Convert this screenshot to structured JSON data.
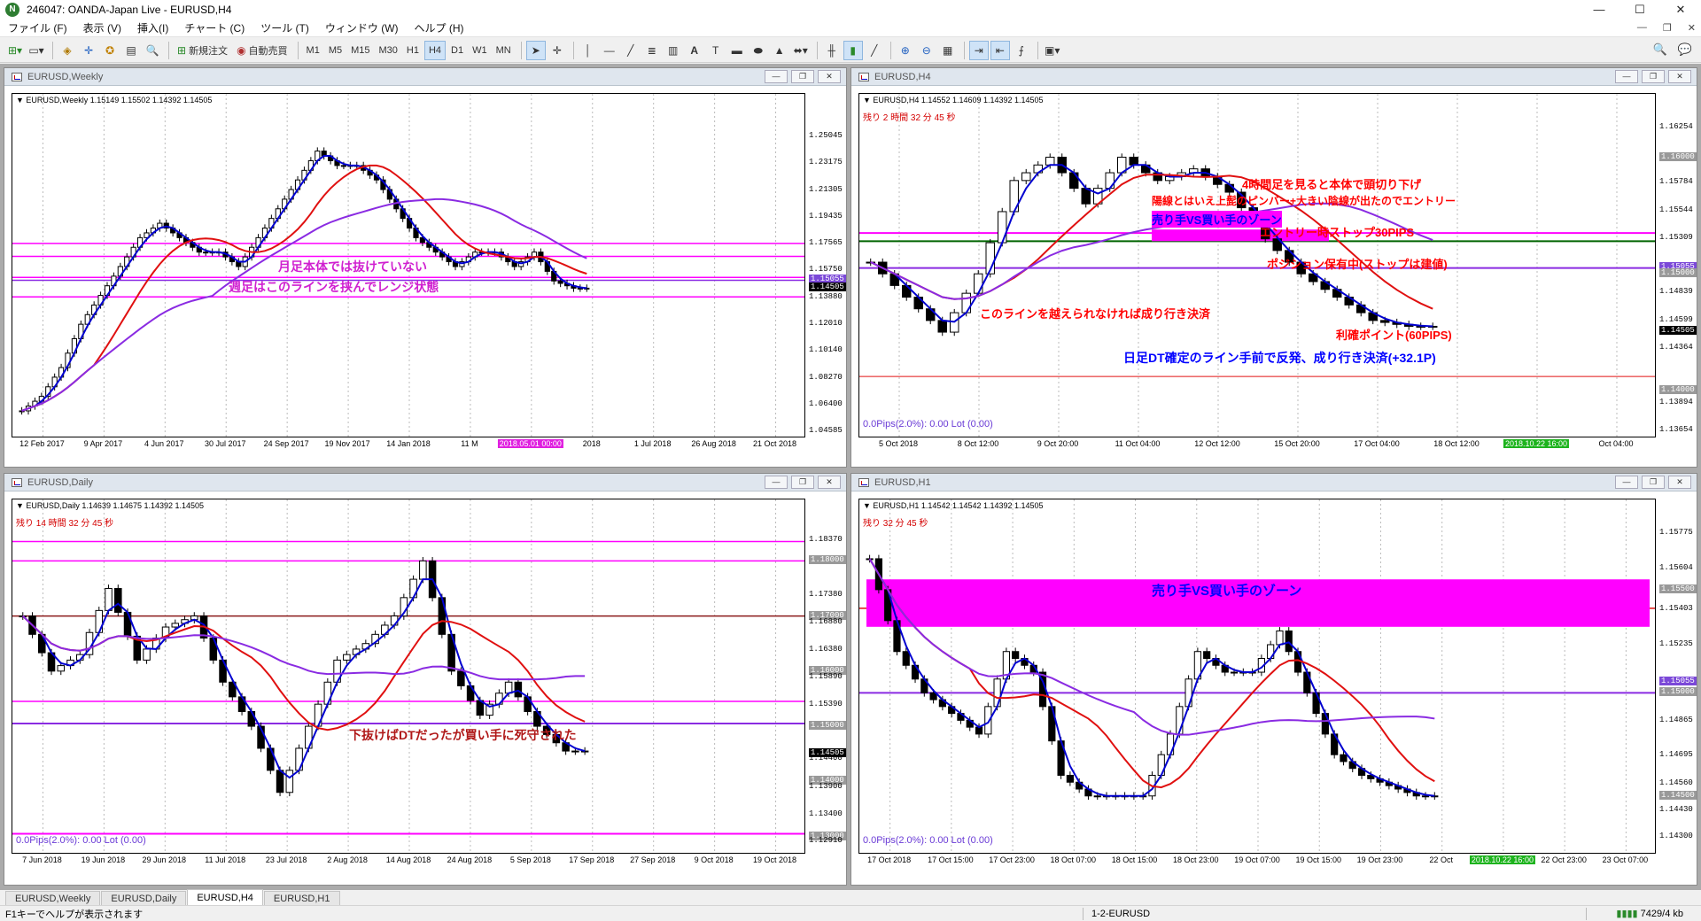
{
  "titlebar": {
    "title": "246047: OANDA-Japan Live - EURUSD,H4",
    "minimize": "—",
    "maximize": "☐",
    "close": "✕"
  },
  "menu": [
    "ファイル (F)",
    "表示 (V)",
    "挿入(I)",
    "チャート (C)",
    "ツール (T)",
    "ウィンドウ (W)",
    "ヘルプ (H)"
  ],
  "toolbar": {
    "new_order": "新規注文",
    "auto_trade": "自動売買",
    "timeframes": [
      "M1",
      "M5",
      "M15",
      "M30",
      "H1",
      "H4",
      "D1",
      "W1",
      "MN"
    ],
    "active_tf": "H4"
  },
  "colors": {
    "bull": "#000000",
    "bear": "#000000",
    "ma_fast": "#0000d0",
    "ma_mid": "#e01010",
    "ma_slow": "#8a2be2",
    "zone": "#ff00ff",
    "support": "#006400",
    "annot_red": "#ff0000",
    "annot_blue": "#0000ff",
    "annot_magenta": "#d020d0",
    "annot_darkred": "#b01818"
  },
  "charts": [
    {
      "id": "weekly",
      "title": "EURUSD,Weekly",
      "info": "▼ EURUSD,Weekly  1.15149 1.15502 1.14392 1.14505",
      "prices": [
        "1.25045",
        "1.23175",
        "1.21305",
        "1.19435",
        "1.17565",
        "1.15750",
        "1.15055",
        "1.14505",
        "1.13880",
        "1.12010",
        "1.10140",
        "1.08270",
        "1.06400",
        "1.04585"
      ],
      "price_boxes": {
        "1.15055": "#7b48d8",
        "1.14505": "#000000"
      },
      "dates": [
        "12 Feb 2017",
        "9 Apr 2017",
        "4 Jun 2017",
        "30 Jul 2017",
        "24 Sep 2017",
        "19 Nov 2017",
        "14 Jan 2018",
        "11 M",
        "2018.05.01 00:00",
        "2018",
        "1 Jul 2018",
        "26 Aug 2018",
        "21 Oct 2018"
      ],
      "date_highlight": "2018.05.01 00:00",
      "annotations": [
        "月足本体では抜けていない",
        "週足はこのラインを挟んでレンジ状態"
      ],
      "chart_data": {
        "type": "candlestick",
        "ylim": [
          1.04585,
          1.26
        ],
        "series": [
          {
            "name": "price",
            "close": [
              1.06,
              1.07,
              1.09,
              1.12,
              1.14,
              1.16,
              1.18,
              1.19,
              1.18,
              1.17,
              1.17,
              1.16,
              1.18,
              1.2,
              1.22,
              1.24,
              1.23,
              1.23,
              1.22,
              1.2,
              1.18,
              1.17,
              1.16,
              1.17,
              1.17,
              1.16,
              1.17,
              1.15,
              1.145
            ]
          }
        ]
      }
    },
    {
      "id": "h4",
      "title": "EURUSD,H4",
      "info": "▼ EURUSD,H4  1.14552 1.14609 1.14392 1.14505",
      "remain": "残り 2 時間 32 分 45 秒",
      "prices": [
        "1.16254",
        "1.16000",
        "1.15784",
        "1.15544",
        "1.15309",
        "1.15055",
        "1.15000",
        "1.14839",
        "1.14599",
        "1.14505",
        "1.14364",
        "1.14000",
        "1.13894",
        "1.13654"
      ],
      "price_boxes": {
        "1.16000": "#999999",
        "1.15055": "#7b48d8",
        "1.15000": "#999999",
        "1.14505": "#000000",
        "1.14000": "#999999"
      },
      "dates": [
        "5 Oct 2018",
        "8 Oct 12:00",
        "9 Oct 20:00",
        "11 Oct 04:00",
        "12 Oct 12:00",
        "15 Oct 20:00",
        "17 Oct 04:00",
        "18 Oct 12:00",
        "2018.10.22 16:00",
        "Oct 04:00"
      ],
      "date_highlight": "2018.10.22 16:00",
      "pips": "0.0Pips(2.0%): 0.00 Lot (0.00)",
      "annotations": [
        "4時間足を見ると本体で頭切り下げ",
        "陽線とはいえ上髭のピンバー+大きい陰線が出たのでエントリー",
        "売り手VS買い手のゾーン",
        "エントリー時ストップ30PIPS",
        "ポジション保有中(ストップは建値)",
        "このラインを越えられなければ成り行き決済",
        "利確ポイント(60PIPS)",
        "日足DT確定のライン手前で反発、成り行き決済(+32.1P)"
      ],
      "chart_data": {
        "type": "candlestick",
        "ylim": [
          1.1365,
          1.163
        ],
        "series": [
          {
            "name": "price",
            "close": [
              1.151,
              1.148,
              1.145,
              1.15,
              1.158,
              1.16,
              1.156,
              1.16,
              1.158,
              1.159,
              1.157,
              1.153,
              1.15,
              1.148,
              1.146,
              1.1455
            ]
          }
        ]
      }
    },
    {
      "id": "daily",
      "title": "EURUSD,Daily",
      "info": "▼ EURUSD,Daily  1.14639 1.14675 1.14392 1.14505",
      "remain": "残り 14 時間 32 分 45 秒",
      "prices": [
        "1.18370",
        "1.18000",
        "1.17380",
        "1.17000",
        "1.16880",
        "1.16380",
        "1.16000",
        "1.15890",
        "1.15390",
        "1.15000",
        "1.14505",
        "1.14400",
        "1.14000",
        "1.13900",
        "1.13400",
        "1.13000",
        "1.12910"
      ],
      "price_boxes": {
        "1.18000": "#999999",
        "1.17000": "#999999",
        "1.16000": "#999999",
        "1.15000": "#999999",
        "1.14505": "#000000",
        "1.14000": "#999999",
        "1.13000": "#999999"
      },
      "dates": [
        "7 Jun 2018",
        "19 Jun 2018",
        "29 Jun 2018",
        "11 Jul 2018",
        "23 Jul 2018",
        "2 Aug 2018",
        "14 Aug 2018",
        "24 Aug 2018",
        "5 Sep 2018",
        "17 Sep 2018",
        "27 Sep 2018",
        "9 Oct 2018",
        "19 Oct 2018"
      ],
      "pips": "0.0Pips(2.0%): 0.00 Lot (0.00)",
      "annotations": [
        "下抜けばDTだったが買い手に死守された"
      ],
      "chart_data": {
        "type": "candlestick",
        "ylim": [
          1.128,
          1.186
        ],
        "series": [
          {
            "name": "price",
            "close": [
              1.17,
              1.16,
              1.163,
              1.175,
              1.162,
              1.168,
              1.17,
              1.158,
              1.15,
              1.138,
              1.15,
              1.162,
              1.165,
              1.17,
              1.18,
              1.16,
              1.152,
              1.158,
              1.15,
              1.1455
            ]
          }
        ]
      }
    },
    {
      "id": "h1",
      "title": "EURUSD,H1",
      "info": "▼ EURUSD,H1  1.14542 1.14542 1.14392 1.14505",
      "remain": "残り 32 分 45 秒",
      "prices": [
        "1.15775",
        "1.15604",
        "1.15500",
        "1.15403",
        "1.15235",
        "1.15055",
        "1.15000",
        "1.14865",
        "1.14695",
        "1.14560",
        "1.14500",
        "1.14430",
        "1.14300"
      ],
      "price_boxes": {
        "1.15500": "#999999",
        "1.15055": "#7b48d8",
        "1.15000": "#999999",
        "1.14500": "#999999"
      },
      "dates": [
        "17 Oct 2018",
        "17 Oct 15:00",
        "17 Oct 23:00",
        "18 Oct 07:00",
        "18 Oct 15:00",
        "18 Oct 23:00",
        "19 Oct 07:00",
        "19 Oct 15:00",
        "19 Oct 23:00",
        "22 Oct",
        "2018.10.22 16:00",
        "22 Oct 23:00",
        "23 Oct 07:00"
      ],
      "date_highlight": "2018.10.22 16:00",
      "pips": "0.0Pips(2.0%): 0.00 Lot (0.00)",
      "annotations": [
        "売り手VS買い手のゾーン"
      ],
      "chart_data": {
        "type": "candlestick",
        "ylim": [
          1.1425,
          1.158
        ],
        "series": [
          {
            "name": "price",
            "close": [
              1.1565,
              1.152,
              1.15,
              1.149,
              1.148,
              1.152,
              1.151,
              1.146,
              1.145,
              1.145,
              1.145,
              1.148,
              1.152,
              1.151,
              1.151,
              1.153,
              1.15,
              1.147,
              1.146,
              1.1455,
              1.145
            ]
          }
        ]
      }
    }
  ],
  "tabs": [
    "EURUSD,Weekly",
    "EURUSD,Daily",
    "EURUSD,H4",
    "EURUSD,H1"
  ],
  "active_tab": "EURUSD,H4",
  "status": {
    "help": "F1キーでヘルプが表示されます",
    "profile": "1-2-EURUSD",
    "connection": "7429/4 kb"
  }
}
